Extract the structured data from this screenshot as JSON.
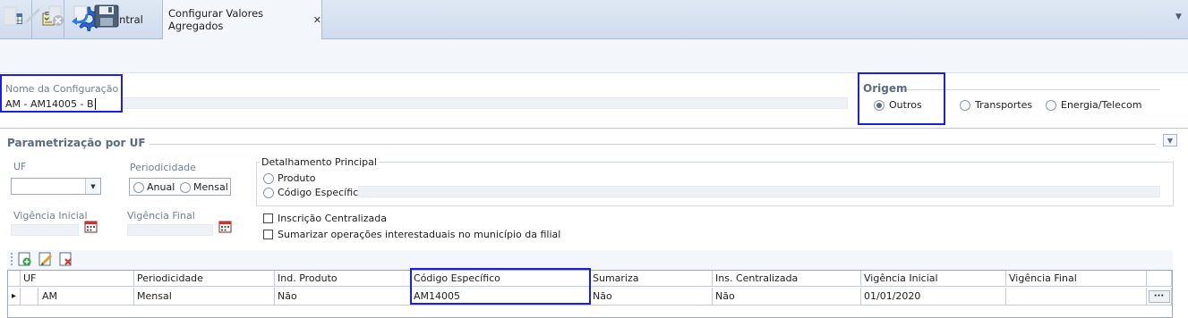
{
  "tabs": {
    "central_label": "Central",
    "active_label": "Configurar Valores Agregados",
    "close_glyph": "✕"
  },
  "form": {
    "nome_label": "Nome da Configuração",
    "nome_value": "AM - AM14005 - B",
    "origem_title": "Origem",
    "origem_options": [
      "Outros",
      "Transportes",
      "Energia/Telecom"
    ],
    "origem_selected": "Outros"
  },
  "param": {
    "title": "Parametrização por UF",
    "uf_label": "UF",
    "uf_value": "",
    "periodicidade_label": "Periodicidade",
    "periodicidade_options": [
      "Anual",
      "Mensal"
    ],
    "vig_inicial_label": "Vigência Inicial",
    "vig_final_label": "Vigência Final",
    "detalhamento_title": "Detalhamento Principal",
    "detalhamento_options": [
      "Produto",
      "Código Específico"
    ],
    "inscricao_label": "Inscrição Centralizada",
    "sumarizar_label": "Sumarizar operações interestaduais no município da filial"
  },
  "grid": {
    "columns": [
      "UF",
      "Periodicidade",
      "Ind. Produto",
      "Código Específico",
      "Sumariza",
      "Ins. Centralizada",
      "Vigência Inicial",
      "Vigência Final"
    ],
    "row": [
      "AM",
      "Mensal",
      "Não",
      "AM14005",
      "Não",
      "Não",
      "01/01/2020",
      ""
    ],
    "row_indicator": "▸",
    "ellipsis": "···"
  },
  "colors": {
    "highlight": "#1c1ee0",
    "tab_bg": "#dfe8f4",
    "gear": "#2a64c6"
  }
}
